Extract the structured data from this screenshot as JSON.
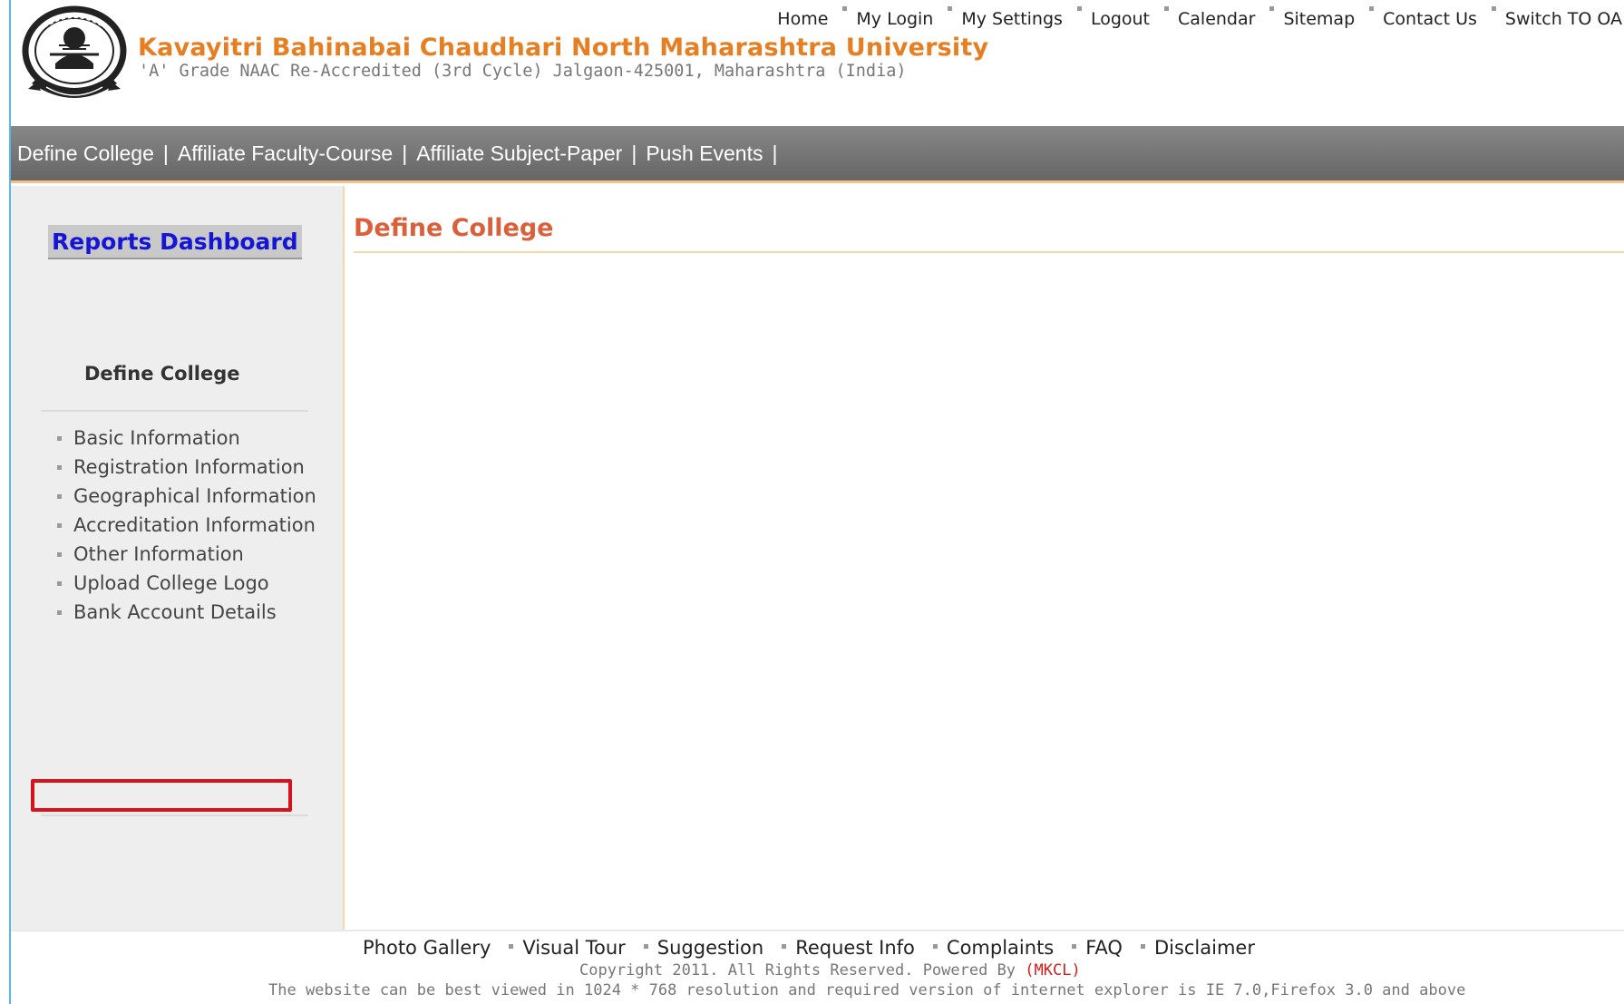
{
  "header": {
    "title": "Kavayitri Bahinabai Chaudhari North Maharashtra University",
    "subtitle": "'A' Grade NAAC Re-Accredited (3rd Cycle) Jalgaon-425001, Maharashtra (India)",
    "logo_icon": "university-seal-icon",
    "top_links": [
      "Home",
      "My Login",
      "My Settings",
      "Logout",
      "Calendar",
      "Sitemap",
      "Contact Us",
      "Switch TO OA"
    ]
  },
  "nav": {
    "items": [
      "Define College",
      "Affiliate Faculty-Course",
      "Affiliate Subject-Paper",
      "Push Events"
    ],
    "separator": "|"
  },
  "sidebar": {
    "reports_button": "Reports Dashboard",
    "heading": "Define College",
    "items": [
      "Basic Information",
      "Registration Information",
      "Geographical Information",
      "Accreditation Information",
      "Other Information",
      "Upload College Logo",
      "Bank Account Details"
    ],
    "highlighted_item": "Bank Account Details"
  },
  "main": {
    "title": "Define College"
  },
  "footer": {
    "links": [
      "Photo Gallery",
      "Visual Tour",
      "Suggestion",
      "Request Info",
      "Complaints",
      "FAQ",
      "Disclaimer"
    ],
    "copyright_prefix": "Copyright 2011. All Rights Reserved. Powered By ",
    "powered_by": "(MKCL)",
    "view_note": "The website can be best viewed in 1024 * 768 resolution and required version of internet explorer is IE 7.0,Firefox 3.0 and above"
  },
  "colors": {
    "accent_orange": "#e67e22",
    "title_red": "#d9603b",
    "nav_gray": "#767676",
    "reports_blue": "#1515d6",
    "highlight_red": "#d6121c"
  }
}
